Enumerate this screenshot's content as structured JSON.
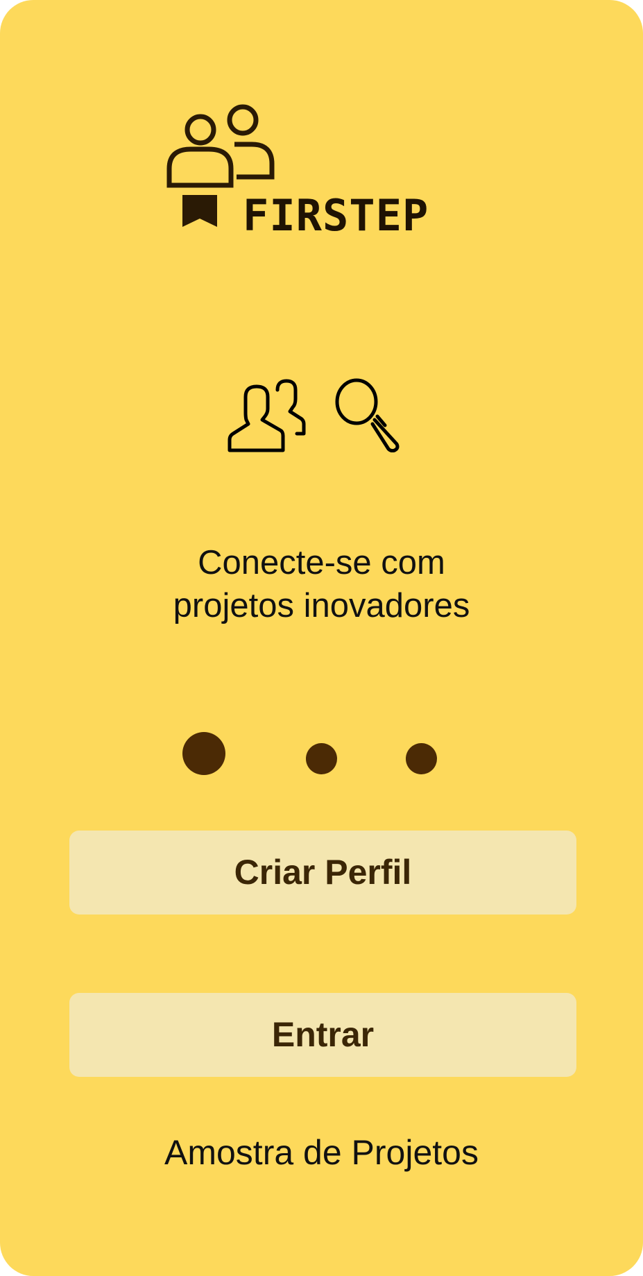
{
  "logo": {
    "wordmark": "FIRSTEP",
    "icon": "people-bookmark-logo-icon"
  },
  "onboarding": {
    "icons": [
      "users-group-icon",
      "search-icon"
    ],
    "tagline_line1": "Conecte-se com",
    "tagline_line2": "projetos inovadores",
    "pager": {
      "total_pages": 3,
      "active_page": 1
    }
  },
  "actions": {
    "create_profile_label": "Criar Perfil",
    "login_label": "Entrar",
    "sample_projects_label": "Amostra de Projetos"
  },
  "colors": {
    "background": "#FDD95B",
    "button_background": "#F4E6B0",
    "button_text": "#3B2606",
    "dot": "#4B2A05",
    "text": "#111111"
  }
}
